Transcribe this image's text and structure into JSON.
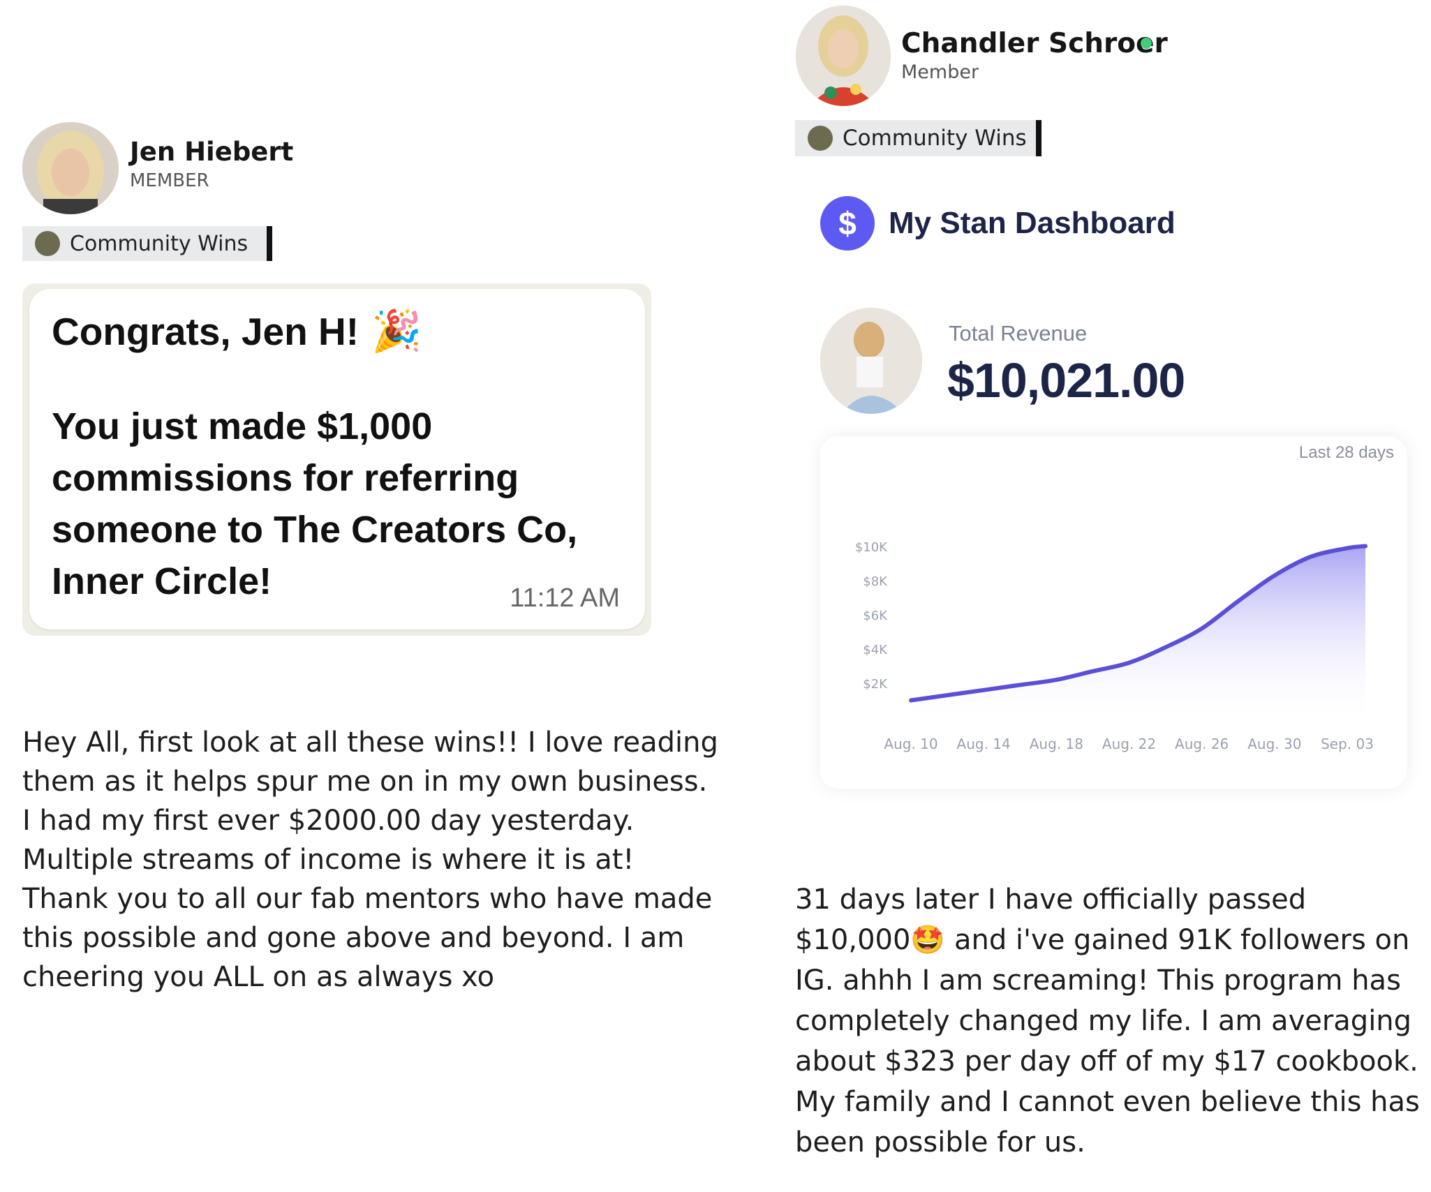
{
  "left_post": {
    "author": {
      "name": "Jen Hiebert",
      "role": "MEMBER"
    },
    "category": "Community Wins",
    "notification": {
      "title": "Congrats, Jen H!",
      "emoji": "🎉",
      "body": "You just made $1,000 commissions for referring someone to The Creators Co, Inner Circle!",
      "time": "11:12 AM"
    },
    "text": "Hey All, first look at all these wins!! I love reading them as it helps spur me on in my own business. I had my first ever $2000.00 day yesterday. Multiple streams of income is where it is at! Thank you to all our fab mentors who have made this possible and gone above and beyond. I am cheering you ALL on as always xo"
  },
  "right_post": {
    "author": {
      "name": "Chandler Schroer",
      "role": "Member",
      "online": true
    },
    "category": "Community Wins",
    "dashboard": {
      "badge_symbol": "$",
      "title": "My Stan Dashboard",
      "revenue_label": "Total Revenue",
      "revenue_value": "$10,021.00",
      "range": "Last 28 days"
    },
    "text_part1": "31 days later I have officially passed $10,000",
    "text_emoji": "🤩",
    "text_part2": " and i've gained 91K followers on IG. ahhh I am screaming! This program has completely changed my life. I am averaging about $323 per day off of my $17 cookbook. My family and I cannot even believe this has been possible for us."
  },
  "colors": {
    "accent": "#5d5af2",
    "line": "#5b4fd6",
    "online": "#3fcf7b",
    "tag_dot": "#6c6a4f"
  },
  "chart_data": {
    "type": "area",
    "title": "",
    "xlabel": "",
    "ylabel": "",
    "x_ticks": [
      "Aug. 10",
      "Aug. 14",
      "Aug. 18",
      "Aug. 22",
      "Aug. 26",
      "Aug. 30",
      "Sep. 03"
    ],
    "y_ticks": [
      "$10K",
      "$8K",
      "$6K",
      "$4K",
      "$2K"
    ],
    "ylim": [
      0,
      10000
    ],
    "series": [
      {
        "x": [
          "Aug. 10",
          "Aug. 12",
          "Aug. 14",
          "Aug. 16",
          "Aug. 18",
          "Aug. 20",
          "Aug. 22",
          "Aug. 24",
          "Aug. 26",
          "Aug. 28",
          "Aug. 30",
          "Sep. 01",
          "Sep. 03",
          "Sep. 04"
        ],
        "values": [
          1000,
          1300,
          1600,
          1900,
          2200,
          2700,
          3200,
          4100,
          5200,
          6800,
          8300,
          9400,
          9900,
          10021
        ]
      }
    ]
  }
}
